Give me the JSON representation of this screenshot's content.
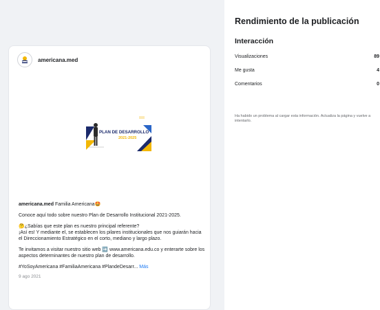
{
  "post": {
    "account_name": "americana.med",
    "image": {
      "title_line1": "PLAN DE DESARROLLO",
      "title_line2": "2021-2025",
      "colors": {
        "navy": "#1b2a6b",
        "yellow": "#f2b705",
        "blue": "#2a66c8"
      }
    },
    "caption": {
      "author": "americana.med",
      "line1": "Familia Americana🤩",
      "para2": "Conoce aquí todo sobre nuestro Plan de Desarrollo Institucional 2021-2025.",
      "para3": "🤔¿Sabías que este plan es nuestro principal referente?\n¡Así es! Y mediante el, se establecen los pilares institucionales que nos guiarán hacia el Direccionamiento Estratégico en el corto, mediano y largo plazo.",
      "para4": "Te invitamos a visitar nuestro sitio web ➡️ www.americana.edu.co y enterarte sobre los aspectos determinantes de nuestro plan de desarrollo.",
      "hashtags": "#YoSoyAmericana #FamiliaAmericana #PlandeDesarr...",
      "more_label": "Más"
    },
    "date": "9 ago 2021"
  },
  "insights": {
    "title": "Rendimiento de la publicación",
    "section": "Interacción",
    "metrics": [
      {
        "label": "Visualizaciones",
        "value": "89"
      },
      {
        "label": "Me gusta",
        "value": "4"
      },
      {
        "label": "Comentarios",
        "value": "0"
      }
    ],
    "error": "Ha habido un problema al cargar esta información. Actualiza la página y vuelve a intentarlo."
  },
  "colors": {
    "background": "#f0f2f5",
    "link": "#1877f2"
  }
}
